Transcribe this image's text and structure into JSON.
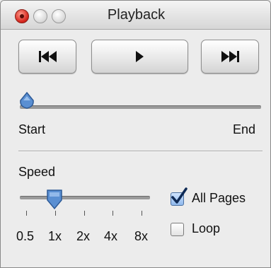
{
  "window": {
    "title": "Playback"
  },
  "transport": {
    "previous": {
      "icon": "skip-back-icon"
    },
    "play": {
      "icon": "play-icon"
    },
    "next": {
      "icon": "skip-forward-icon"
    }
  },
  "position": {
    "start_label": "Start",
    "end_label": "End",
    "value": 0.0
  },
  "speed": {
    "label": "Speed",
    "ticks": [
      "0.5",
      "1x",
      "2x",
      "4x",
      "8x"
    ],
    "selected": "1x"
  },
  "options": {
    "all_pages": {
      "label": "All Pages",
      "checked": true
    },
    "loop": {
      "label": "Loop",
      "checked": false
    }
  },
  "colors": {
    "knob": "#5a8fd2",
    "close": "#d7271f"
  }
}
